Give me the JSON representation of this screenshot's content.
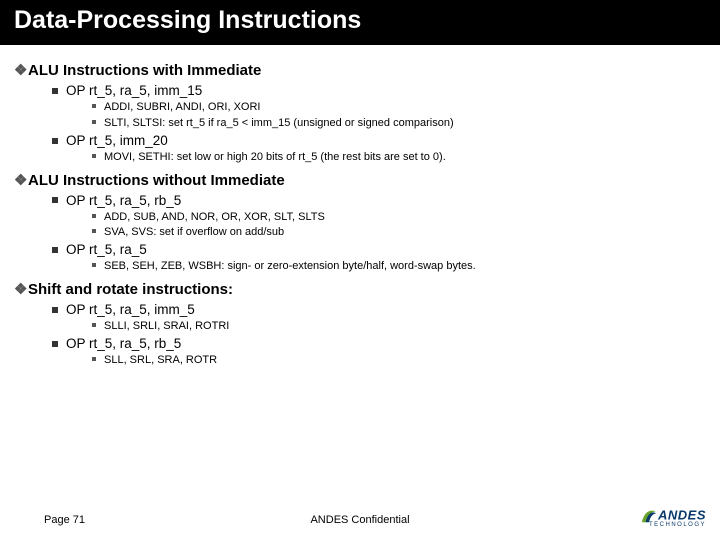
{
  "title": "Data-Processing Instructions",
  "sections": [
    {
      "heading": "ALU Instructions with Immediate",
      "ops": [
        {
          "sig": "OP  rt_5, ra_5, imm_15",
          "details": [
            "ADDI, SUBRI, ANDI, ORI, XORI",
            "SLTI, SLTSI: set rt_5 if ra_5 < imm_15 (unsigned or signed comparison)"
          ]
        },
        {
          "sig": "OP  rt_5, imm_20",
          "details": [
            "MOVI, SETHI: set low or high 20 bits of rt_5 (the rest bits are set to 0)."
          ]
        }
      ]
    },
    {
      "heading": "ALU Instructions without Immediate",
      "ops": [
        {
          "sig": "OP  rt_5, ra_5, rb_5",
          "details": [
            "ADD, SUB, AND, NOR, OR, XOR, SLT, SLTS",
            "SVA, SVS: set if overflow on add/sub"
          ]
        },
        {
          "sig": "OP  rt_5, ra_5",
          "details": [
            "SEB, SEH, ZEB, WSBH: sign- or zero-extension byte/half, word-swap bytes."
          ]
        }
      ]
    },
    {
      "heading": "Shift and rotate instructions:",
      "ops": [
        {
          "sig": "OP  rt_5, ra_5, imm_5",
          "details": [
            "SLLI, SRLI, SRAI, ROTRI"
          ]
        },
        {
          "sig": "OP  rt_5, ra_5, rb_5",
          "details": [
            "SLL, SRL, SRA, ROTR"
          ]
        }
      ]
    }
  ],
  "footer": {
    "page": "Page 71",
    "confidential": "ANDES Confidential",
    "logo_name": "ANDES",
    "logo_tech": "TECHNOLOGY"
  }
}
